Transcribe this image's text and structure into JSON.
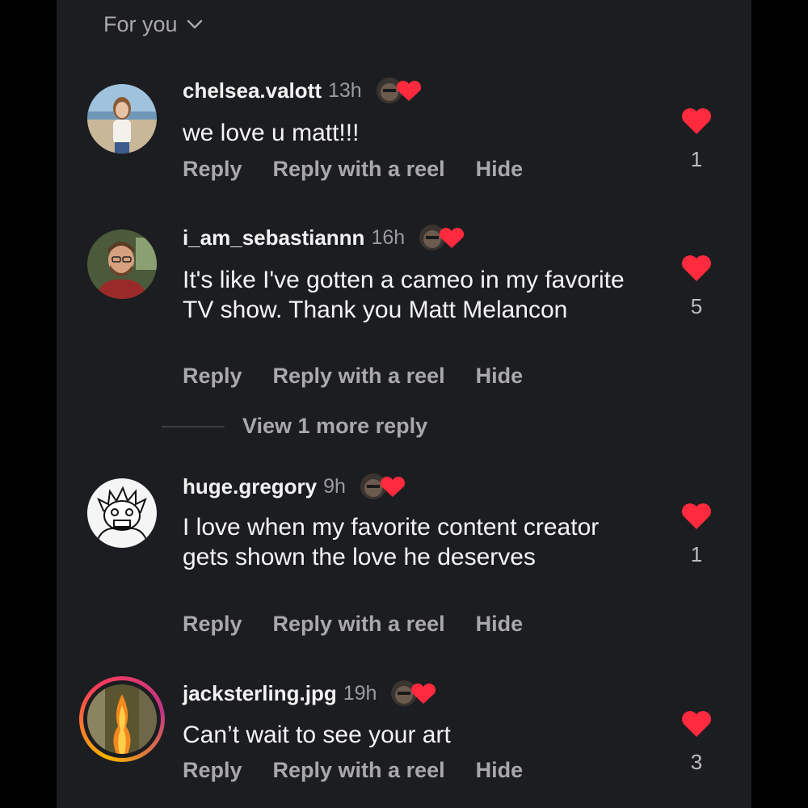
{
  "header": {
    "sort_label": "For you"
  },
  "colors": {
    "background": "#1c1d20",
    "heart": "#ff2a3d",
    "muted_text": "#a8a8ad"
  },
  "comments": [
    {
      "username": "chelsea.valott",
      "time": "13h",
      "text": "we love u matt!!!",
      "actions": [
        "Reply",
        "Reply with a reel",
        "Hide"
      ],
      "likes": "1"
    },
    {
      "username": "i_am_sebastiannn",
      "time": "16h",
      "text": "It's like I've gotten a cameo in my favorite TV show. Thank you Matt Melancon",
      "actions": [
        "Reply",
        "Reply with a reel",
        "Hide"
      ],
      "likes": "5"
    },
    {
      "username": "huge.gregory",
      "time": "9h",
      "text": "I love when my favorite content creator gets shown the love he deserves",
      "actions": [
        "Reply",
        "Reply with a reel",
        "Hide"
      ],
      "likes": "1"
    },
    {
      "username": "jacksterling.jpg",
      "time": "19h",
      "text": "Can’t wait to see your art",
      "actions": [
        "Reply",
        "Reply with a reel",
        "Hide"
      ],
      "likes": "3"
    }
  ],
  "view_more": "View 1 more reply"
}
